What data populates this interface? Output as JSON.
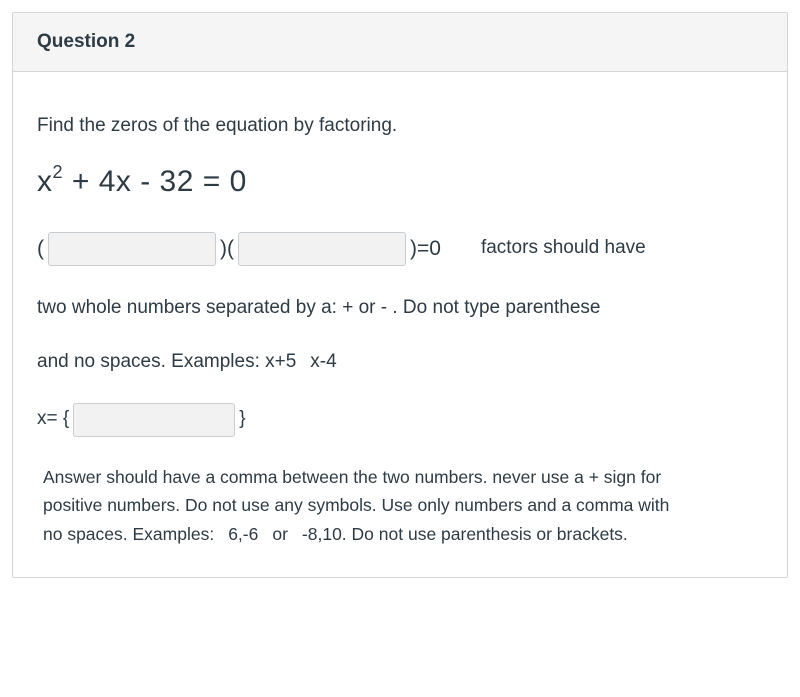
{
  "header": {
    "title": "Question 2"
  },
  "body": {
    "instruction": "Find the zeros of the equation by factoring.",
    "equation_prefix": "x",
    "equation_exp": "2",
    "equation_rest": " + 4x - 32  = 0",
    "factor_open1": "(",
    "factor_close_open": ")(",
    "factor_close_eq": ")=0",
    "factor_trail": "factors should have",
    "hint_line1": "two whole numbers separated by a: + or - .  Do not type parenthese",
    "hint_line2_a": "and no spaces.  Examples:  x+5",
    "hint_line2_b": "x-4",
    "x_label": "x= {",
    "x_close": "}",
    "answer_note_1": "Answer should have a comma between the two numbers.  never use a + sign for",
    "answer_note_2": "positive numbers.  Do not use any symbols.  Use only numbers and a comma with",
    "answer_note_3a": "no spaces.  Examples:",
    "answer_note_3b": "6,-6",
    "answer_note_3c": "or",
    "answer_note_3d": "-8,10.  Do not use parenthesis or brackets.",
    "inputs": {
      "factor1": "",
      "factor2": "",
      "solution": ""
    }
  }
}
